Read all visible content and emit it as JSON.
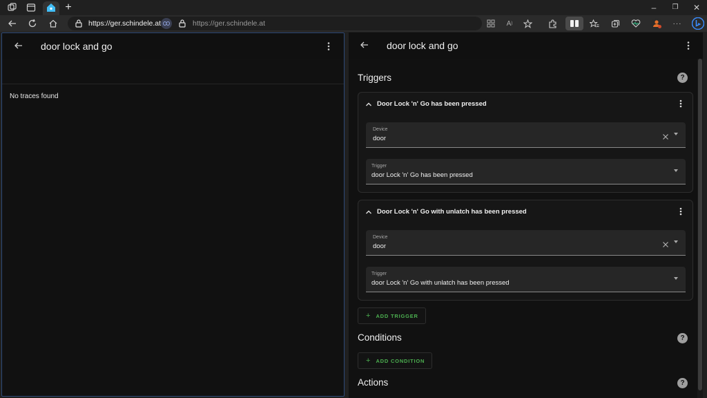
{
  "browser": {
    "url_secure": "https://ger.schindele.at",
    "url_display": "https://ger.schindele.at",
    "tab_new_label": "+",
    "win_minimize": "–",
    "win_restore": "❐",
    "win_close": "✕",
    "more_label": "···"
  },
  "left_pane": {
    "title": "door lock and go",
    "empty_message": "No traces found"
  },
  "right_pane": {
    "title": "door lock and go",
    "triggers": {
      "heading": "Triggers",
      "help": "?",
      "items": [
        {
          "title": "Door Lock 'n' Go has been pressed",
          "device_label": "Device",
          "device_value": "door",
          "trigger_label": "Trigger",
          "trigger_value": "door Lock 'n' Go has been pressed"
        },
        {
          "title": "Door Lock 'n' Go with unlatch has been pressed",
          "device_label": "Device",
          "device_value": "door",
          "trigger_label": "Trigger",
          "trigger_value": "door Lock 'n' Go with unlatch has been pressed"
        }
      ],
      "add_label": "ADD TRIGGER"
    },
    "conditions": {
      "heading": "Conditions",
      "help": "?",
      "add_label": "ADD CONDITION"
    },
    "actions": {
      "heading": "Actions",
      "help": "?"
    }
  },
  "colors": {
    "accent_green": "#4caf50",
    "background": "#111111",
    "card_bg": "#161616",
    "field_bg": "#262626"
  }
}
